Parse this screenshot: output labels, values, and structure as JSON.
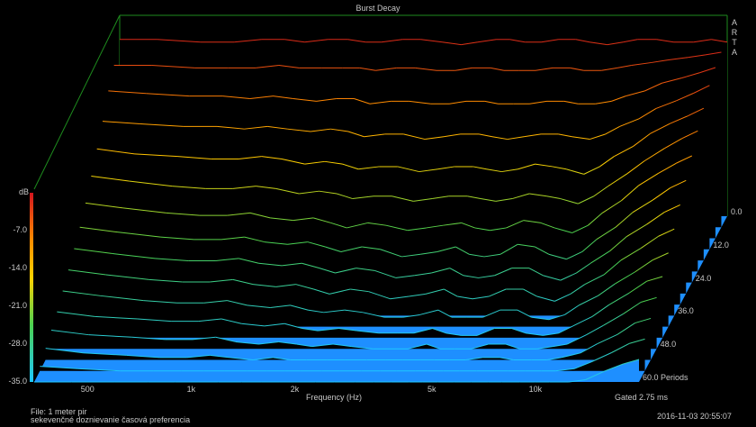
{
  "chart_data": {
    "type": "waterfall",
    "title": "Burst Decay",
    "brand": "ARTA",
    "xlabel": "Frequency (Hz)",
    "zlabel": "dB",
    "x_tick_labels": [
      "500",
      "1k",
      "2k",
      "5k",
      "10k"
    ],
    "x_tick_values": [
      500,
      1000,
      2000,
      5000,
      10000
    ],
    "z_tick_labels": [
      "-7.0",
      "-14.0",
      "-21.0",
      "-28.0",
      "-35.0"
    ],
    "z_tick_values": [
      -7,
      -14,
      -21,
      -28,
      -35
    ],
    "zlim": [
      -35,
      0
    ],
    "y_tick_labels": [
      "0.0",
      "12.0",
      "24.0",
      "36.0",
      "48.0",
      "60.0 Periods"
    ],
    "y_tick_values": [
      0,
      12,
      24,
      36,
      48,
      60
    ],
    "gated_label": "Gated 2.75 ms",
    "file_label": "File: 1 meter pir",
    "description_label": "sekevenčné doznievanie časová  preferencia",
    "timestamp_label": "2016-11-03   20:55:07",
    "frequencies_hz": [
      350,
      450,
      600,
      750,
      900,
      1050,
      1200,
      1400,
      1600,
      1800,
      2000,
      2300,
      2600,
      3000,
      3400,
      3800,
      4300,
      4700,
      5200,
      5800,
      6500,
      7300,
      8000,
      9000,
      10000,
      11000,
      12500,
      14000,
      16000,
      18000,
      20000
    ],
    "decay_periods": [
      0,
      4,
      8,
      12,
      16,
      20,
      24,
      28,
      32,
      36,
      40,
      44,
      48,
      52,
      56,
      60
    ],
    "level_db": [
      [
        -1.5,
        -1.5,
        -2.0,
        -2.0,
        -1.5,
        -1.5,
        -2.0,
        -1.5,
        -1.5,
        -2.0,
        -2.0,
        -1.5,
        -1.5,
        -2.0,
        -2.5,
        -2.0,
        -1.5,
        -1.5,
        -2.0,
        -2.0,
        -1.5,
        -1.5,
        -2.0,
        -2.5,
        -2.0,
        -1.5,
        -1.5,
        -2.0,
        -2.0,
        -1.5,
        -2.0
      ],
      [
        -4.0,
        -4.0,
        -4.5,
        -4.5,
        -4.5,
        -4.0,
        -4.5,
        -4.5,
        -4.5,
        -4.5,
        -5.0,
        -4.5,
        -4.5,
        -5.0,
        -5.0,
        -4.5,
        -4.5,
        -5.0,
        -5.0,
        -5.0,
        -4.5,
        -4.5,
        -5.0,
        -5.0,
        -4.5,
        -4.0,
        -3.5,
        -3.0,
        -2.5,
        -2.0,
        -1.5
      ],
      [
        -6.5,
        -7.0,
        -7.5,
        -7.5,
        -8.0,
        -7.5,
        -8.0,
        -8.5,
        -8.0,
        -8.0,
        -9.0,
        -8.5,
        -8.5,
        -9.0,
        -9.0,
        -8.5,
        -8.5,
        -9.0,
        -9.0,
        -9.0,
        -8.5,
        -8.5,
        -9.0,
        -9.0,
        -8.5,
        -7.5,
        -6.5,
        -5.0,
        -4.0,
        -3.0,
        -2.0
      ],
      [
        -10.0,
        -10.5,
        -11.0,
        -11.0,
        -11.5,
        -11.0,
        -11.5,
        -12.0,
        -11.5,
        -12.0,
        -13.0,
        -12.5,
        -12.5,
        -13.5,
        -13.0,
        -12.5,
        -12.5,
        -13.0,
        -13.5,
        -13.0,
        -12.5,
        -12.5,
        -13.0,
        -13.5,
        -12.5,
        -11.0,
        -9.5,
        -7.5,
        -6.0,
        -4.5,
        -3.0
      ],
      [
        -13.0,
        -14.0,
        -14.5,
        -15.0,
        -15.0,
        -14.5,
        -15.0,
        -16.0,
        -15.5,
        -16.0,
        -17.0,
        -16.5,
        -16.5,
        -17.5,
        -17.0,
        -16.5,
        -16.5,
        -17.0,
        -17.5,
        -17.0,
        -16.0,
        -16.5,
        -17.0,
        -18.0,
        -16.5,
        -14.5,
        -12.5,
        -10.0,
        -8.0,
        -6.5,
        -5.0
      ],
      [
        -16.0,
        -17.0,
        -18.0,
        -18.5,
        -18.5,
        -18.0,
        -18.5,
        -19.5,
        -19.0,
        -19.5,
        -20.5,
        -20.0,
        -20.0,
        -21.0,
        -20.5,
        -20.0,
        -20.0,
        -20.5,
        -21.0,
        -20.5,
        -19.5,
        -20.0,
        -20.5,
        -21.5,
        -20.0,
        -18.0,
        -15.5,
        -13.0,
        -10.5,
        -8.5,
        -7.0
      ],
      [
        -19.0,
        -20.0,
        -21.0,
        -21.5,
        -21.5,
        -21.0,
        -22.0,
        -22.5,
        -22.0,
        -23.0,
        -24.0,
        -23.0,
        -23.5,
        -24.5,
        -24.0,
        -23.5,
        -23.0,
        -24.0,
        -24.5,
        -24.0,
        -22.5,
        -23.0,
        -24.0,
        -25.0,
        -23.5,
        -21.0,
        -18.5,
        -15.5,
        -13.0,
        -11.0,
        -9.5
      ],
      [
        -21.5,
        -22.5,
        -23.5,
        -24.0,
        -24.0,
        -23.5,
        -24.5,
        -25.0,
        -24.5,
        -25.5,
        -26.5,
        -25.5,
        -26.0,
        -27.5,
        -27.0,
        -26.5,
        -25.5,
        -27.0,
        -27.5,
        -27.0,
        -25.0,
        -25.5,
        -27.0,
        -28.0,
        -26.5,
        -24.0,
        -21.5,
        -18.5,
        -16.0,
        -13.5,
        -12.0
      ],
      [
        -23.5,
        -24.5,
        -25.5,
        -26.0,
        -26.0,
        -25.5,
        -26.5,
        -27.0,
        -26.5,
        -27.5,
        -28.5,
        -27.5,
        -28.0,
        -29.5,
        -29.0,
        -28.5,
        -27.5,
        -29.0,
        -29.5,
        -29.0,
        -27.5,
        -27.5,
        -29.0,
        -30.0,
        -28.5,
        -26.5,
        -24.0,
        -21.0,
        -18.5,
        -16.0,
        -14.5
      ],
      [
        -25.5,
        -26.5,
        -27.5,
        -28.0,
        -28.0,
        -27.5,
        -28.5,
        -29.0,
        -28.5,
        -29.5,
        -30.5,
        -29.5,
        -30.0,
        -31.5,
        -31.0,
        -30.5,
        -29.5,
        -31.0,
        -31.5,
        -31.0,
        -29.5,
        -29.5,
        -31.0,
        -32.0,
        -30.5,
        -28.5,
        -26.5,
        -23.5,
        -21.0,
        -18.5,
        -17.0
      ],
      [
        -27.5,
        -28.5,
        -29.5,
        -30.0,
        -30.0,
        -29.5,
        -30.5,
        -31.0,
        -30.5,
        -31.5,
        -32.0,
        -31.5,
        -32.0,
        -33.0,
        -33.0,
        -32.5,
        -31.5,
        -33.0,
        -33.0,
        -33.0,
        -31.5,
        -31.5,
        -33.0,
        -33.5,
        -32.5,
        -30.5,
        -28.5,
        -26.0,
        -23.5,
        -21.0,
        -19.5
      ],
      [
        -29.5,
        -30.5,
        -31.0,
        -31.5,
        -31.5,
        -31.0,
        -32.0,
        -32.5,
        -32.0,
        -33.0,
        -33.5,
        -33.0,
        -33.5,
        -34.0,
        -34.0,
        -34.0,
        -33.0,
        -34.0,
        -34.5,
        -34.5,
        -33.0,
        -33.0,
        -34.0,
        -34.5,
        -34.0,
        -32.5,
        -30.5,
        -28.0,
        -25.5,
        -23.0,
        -22.0
      ],
      [
        -31.0,
        -32.0,
        -32.5,
        -33.0,
        -33.0,
        -32.5,
        -33.5,
        -34.0,
        -33.5,
        -34.0,
        -34.5,
        -34.0,
        -34.5,
        -35.0,
        -35.0,
        -35.0,
        -34.0,
        -35.0,
        -35.0,
        -35.0,
        -34.0,
        -34.0,
        -35.0,
        -35.0,
        -34.5,
        -34.0,
        -32.0,
        -30.0,
        -27.5,
        -25.0,
        -24.0
      ],
      [
        -32.5,
        -33.5,
        -34.0,
        -34.5,
        -34.5,
        -34.0,
        -34.5,
        -35.0,
        -34.5,
        -35.0,
        -35.0,
        -35.0,
        -35.0,
        -35.0,
        -35.0,
        -35.0,
        -35.0,
        -35.0,
        -35.0,
        -35.0,
        -34.5,
        -34.5,
        -35.0,
        -35.0,
        -35.0,
        -34.5,
        -33.5,
        -31.5,
        -29.5,
        -27.0,
        -26.0
      ],
      [
        -34.0,
        -34.5,
        -35.0,
        -35.0,
        -35.0,
        -35.0,
        -35.0,
        -35.0,
        -35.0,
        -35.0,
        -35.0,
        -35.0,
        -35.0,
        -35.0,
        -35.0,
        -35.0,
        -35.0,
        -35.0,
        -35.0,
        -35.0,
        -35.0,
        -35.0,
        -35.0,
        -35.0,
        -35.0,
        -35.0,
        -34.5,
        -33.0,
        -31.0,
        -29.0,
        -28.0
      ],
      [
        -35.0,
        -35.0,
        -35.0,
        -35.0,
        -35.0,
        -35.0,
        -35.0,
        -35.0,
        -35.0,
        -35.0,
        -35.0,
        -35.0,
        -35.0,
        -35.0,
        -35.0,
        -35.0,
        -35.0,
        -35.0,
        -35.0,
        -35.0,
        -35.0,
        -35.0,
        -35.0,
        -35.0,
        -35.0,
        -35.0,
        -35.0,
        -34.5,
        -32.5,
        -31.0,
        -30.0
      ]
    ],
    "colors": {
      "background": "#000000",
      "floor": "#1e8fff",
      "frame": "#1e8c1e",
      "text": "#c8c8c8",
      "colorbar": [
        "#d2141e",
        "#ff8c00",
        "#ffd200",
        "#4bd250",
        "#1ec8ff"
      ]
    }
  }
}
